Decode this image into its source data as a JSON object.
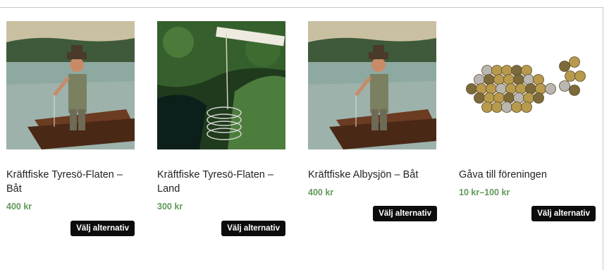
{
  "products": [
    {
      "title": "Kräftfiske Tyresö-Flaten – Båt",
      "price": "400 kr",
      "button": "Välj alternativ",
      "image": "fisherman-boat-painting"
    },
    {
      "title": "Kräftfiske Tyresö-Flaten – Land",
      "price": "300 kr",
      "button": "Välj alternativ",
      "image": "crayfish-trap-photo"
    },
    {
      "title": "Kräftfiske Albysjön – Båt",
      "price": "400 kr",
      "button": "Välj alternativ",
      "image": "fisherman-boat-painting"
    },
    {
      "title": "Gåva till föreningen",
      "price": "10 kr–100 kr",
      "button": "Välj alternativ",
      "image": "coins-fish-shape"
    }
  ],
  "colors": {
    "price": "#5f9a5a",
    "button_bg": "#0c0c0c",
    "button_text": "#ffffff"
  }
}
